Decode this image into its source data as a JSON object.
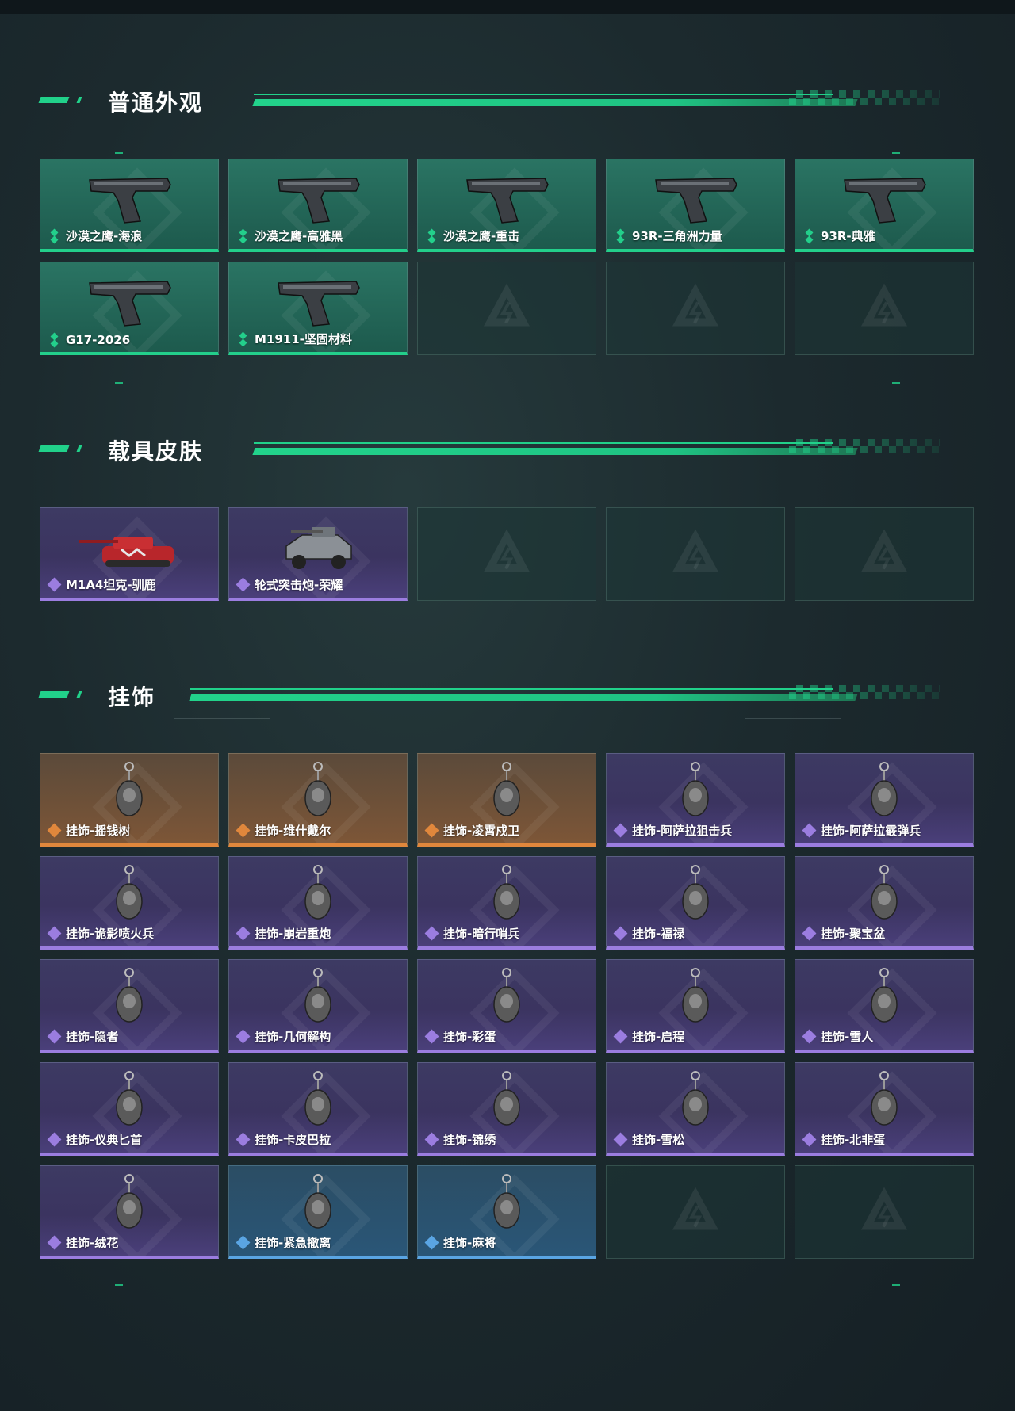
{
  "sections": [
    {
      "title": "普通外观",
      "items": [
        {
          "label": "沙漠之鹰-海浪",
          "rarity": "green",
          "icon": "pistol-icon"
        },
        {
          "label": "沙漠之鹰-高雅黑",
          "rarity": "green",
          "icon": "pistol-icon"
        },
        {
          "label": "沙漠之鹰-重击",
          "rarity": "green",
          "icon": "pistol-icon"
        },
        {
          "label": "93R-三角洲力量",
          "rarity": "green",
          "icon": "pistol-icon"
        },
        {
          "label": "93R-典雅",
          "rarity": "green",
          "icon": "pistol-icon"
        },
        {
          "label": "G17-2026",
          "rarity": "green",
          "icon": "pistol-icon"
        },
        {
          "label": "M1911-坚固材料",
          "rarity": "green",
          "icon": "pistol-icon"
        },
        {
          "label": "",
          "rarity": "empty",
          "icon": "delta-logo-icon"
        },
        {
          "label": "",
          "rarity": "empty",
          "icon": "delta-logo-icon"
        },
        {
          "label": "",
          "rarity": "empty",
          "icon": "delta-logo-icon"
        }
      ]
    },
    {
      "title": "载具皮肤",
      "items": [
        {
          "label": "M1A4坦克-驯鹿",
          "rarity": "purple",
          "icon": "tank-icon"
        },
        {
          "label": "轮式突击炮-荣耀",
          "rarity": "purple",
          "icon": "armored-vehicle-icon"
        },
        {
          "label": "",
          "rarity": "empty",
          "icon": "delta-logo-icon"
        },
        {
          "label": "",
          "rarity": "empty",
          "icon": "delta-logo-icon"
        },
        {
          "label": "",
          "rarity": "empty",
          "icon": "delta-logo-icon"
        }
      ]
    },
    {
      "title": "挂饰",
      "items": [
        {
          "label": "挂饰-摇钱树",
          "rarity": "orange",
          "icon": "charm-icon"
        },
        {
          "label": "挂饰-维什戴尔",
          "rarity": "orange",
          "icon": "charm-icon"
        },
        {
          "label": "挂饰-凌霄戍卫",
          "rarity": "orange",
          "icon": "charm-icon"
        },
        {
          "label": "挂饰-阿萨拉狙击兵",
          "rarity": "purple",
          "icon": "charm-icon"
        },
        {
          "label": "挂饰-阿萨拉霰弹兵",
          "rarity": "purple",
          "icon": "charm-icon"
        },
        {
          "label": "挂饰-诡影喷火兵",
          "rarity": "purple",
          "icon": "charm-icon"
        },
        {
          "label": "挂饰-崩岩重炮",
          "rarity": "purple",
          "icon": "charm-icon"
        },
        {
          "label": "挂饰-暗行哨兵",
          "rarity": "purple",
          "icon": "charm-icon"
        },
        {
          "label": "挂饰-福禄",
          "rarity": "purple",
          "icon": "charm-icon"
        },
        {
          "label": "挂饰-聚宝盆",
          "rarity": "purple",
          "icon": "charm-icon"
        },
        {
          "label": "挂饰-隐者",
          "rarity": "purple",
          "icon": "charm-icon"
        },
        {
          "label": "挂饰-几何解构",
          "rarity": "purple",
          "icon": "charm-icon"
        },
        {
          "label": "挂饰-彩蛋",
          "rarity": "purple",
          "icon": "charm-icon"
        },
        {
          "label": "挂饰-启程",
          "rarity": "purple",
          "icon": "charm-icon"
        },
        {
          "label": "挂饰-雪人",
          "rarity": "purple",
          "icon": "charm-icon"
        },
        {
          "label": "挂饰-仪典匕首",
          "rarity": "purple",
          "icon": "charm-icon"
        },
        {
          "label": "挂饰-卡皮巴拉",
          "rarity": "purple",
          "icon": "charm-icon"
        },
        {
          "label": "挂饰-锦绣",
          "rarity": "purple",
          "icon": "charm-icon"
        },
        {
          "label": "挂饰-雪松",
          "rarity": "purple",
          "icon": "charm-icon"
        },
        {
          "label": "挂饰-北非蛋",
          "rarity": "purple",
          "icon": "charm-icon"
        },
        {
          "label": "挂饰-绒花",
          "rarity": "purple",
          "icon": "charm-icon"
        },
        {
          "label": "挂饰-紧急撤离",
          "rarity": "blue",
          "icon": "charm-icon"
        },
        {
          "label": "挂饰-麻将",
          "rarity": "blue",
          "icon": "charm-icon"
        },
        {
          "label": "",
          "rarity": "empty",
          "icon": "delta-logo-icon"
        },
        {
          "label": "",
          "rarity": "empty",
          "icon": "delta-logo-icon"
        }
      ]
    }
  ],
  "colors": {
    "accent": "#21d18a",
    "green": "#23cf8b",
    "purple": "#9b7de0",
    "orange": "#e0873c",
    "blue": "#5aa5e3"
  }
}
